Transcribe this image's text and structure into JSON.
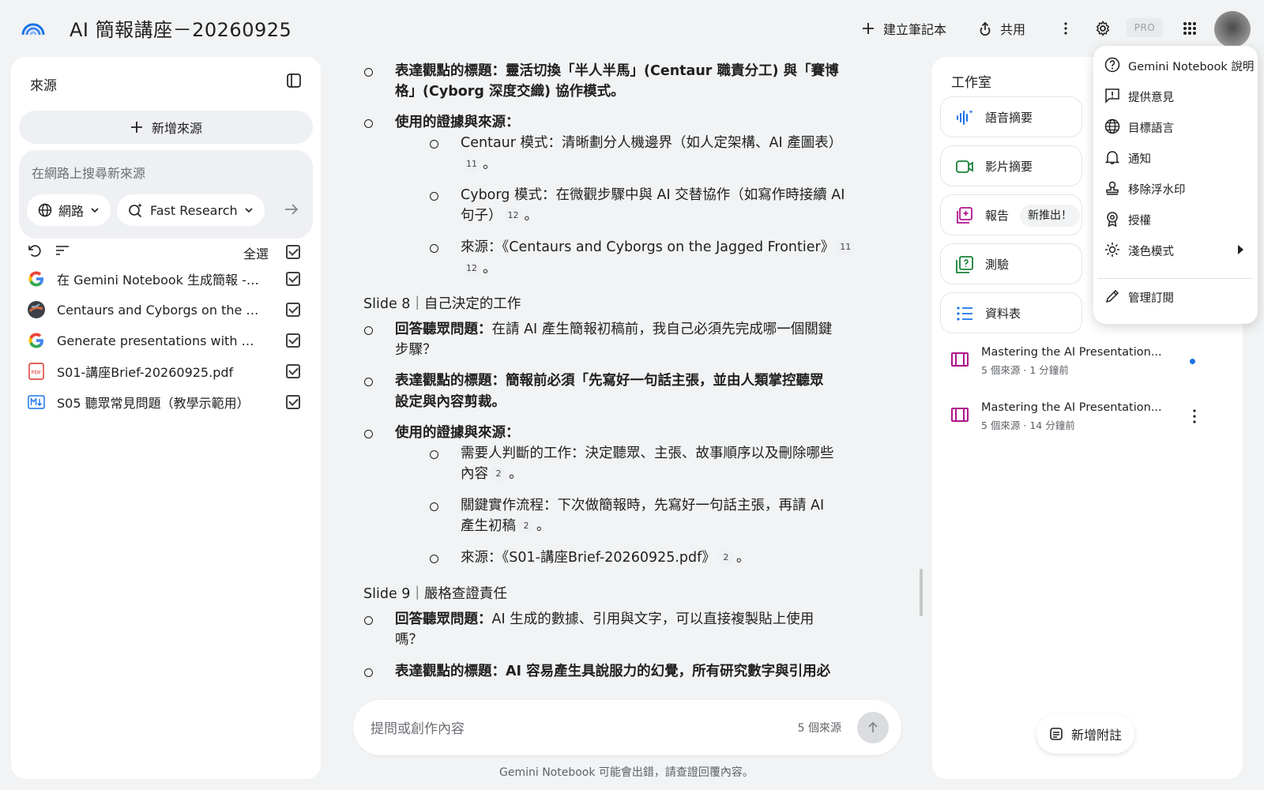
{
  "app": {
    "title": "AI 簡報講座－20260925"
  },
  "toolbar": {
    "create_notebook": "建立筆記本",
    "share": "共用",
    "pro_badge": "PRO"
  },
  "sources_panel": {
    "title": "來源",
    "add_source": "新增來源",
    "search_placeholder": "在網路上搜尋新來源",
    "web_chip": "網路",
    "research_chip": "Fast Research",
    "select_all": "全選",
    "items": [
      {
        "label": "在 Gemini Notebook 生成簡報 - ...",
        "icon": "google-icon"
      },
      {
        "label": "Centaurs and Cyborgs on the Ja...",
        "icon": "globe-favicon-icon"
      },
      {
        "label": "Generate presentations with Ge...",
        "icon": "google-icon"
      },
      {
        "label": "S01-講座Brief-20260925.pdf",
        "icon": "pdf-icon"
      },
      {
        "label": "S05 聽眾常見問題（教學示範用）",
        "icon": "markdown-icon"
      }
    ]
  },
  "content": {
    "l1a": "表達觀點的標題：",
    "l1b": "靈活切換「半人半馬」(Centaur 職責分工) 與「賽博",
    "l1c": "格」(Cyborg 深度交織) 協作模式。",
    "l2": "使用的證據與來源：",
    "l3a": "Centaur 模式：清晰劃分人機邊界（如人定架構、AI 產圖表）",
    "l3cite": "11",
    "l4a": "Cyborg 模式：在微觀步驟中與 AI 交替協作（如寫作時接續 AI",
    "l4b": "句子）",
    "l4cite": "12",
    "l5a": "來源：《Centaurs and Cyborgs on the Jagged Frontier》",
    "l5cite1": "11",
    "l5cite2": "12",
    "slide8": "Slide 8｜自己決定的工作",
    "s8q_label": "回答聽眾問題：",
    "s8q_text": "在請 AI 產生簡報初稿前，我自己必須先完成哪一個關鍵",
    "s8q_text2": "步驟？",
    "s8t_label": "表達觀點的標題：",
    "s8t_text": "簡報前必須「先寫好一句話主張，並由人類掌控聽眾",
    "s8t_text2": "設定與內容剪裁。",
    "s8e_label": "使用的證據與來源：",
    "s8e1": "需要人判斷的工作：決定聽眾、主張、故事順序以及刪除哪些",
    "s8e1b": "內容",
    "s8e1cite": "2",
    "s8e2": "關鍵實作流程：下次做簡報時，先寫好一句話主張，再請 AI",
    "s8e2b": "產生初稿",
    "s8e2cite": "2",
    "s8e3": "來源：《S01-講座Brief-20260925.pdf》",
    "s8e3cite": "2",
    "period": "。",
    "slide9": "Slide 9｜嚴格查證責任",
    "s9q_label": "回答聽眾問題：",
    "s9q_text": "AI 生成的數據、引用與文字，可以直接複製貼上使用",
    "s9q_text2": "嗎？",
    "s9t_label": "表達觀點的標題：",
    "s9t_text": "AI 容易產生具說服力的幻覺，所有研究數字與引用必"
  },
  "chat": {
    "placeholder": "提問或創作內容",
    "source_count": "5 個來源"
  },
  "footer": {
    "disclaimer": "Gemini Notebook 可能會出錯，請查證回覆內容。"
  },
  "studio": {
    "title": "工作室",
    "cards": [
      {
        "label": "語音摘要"
      },
      {
        "label": "影片摘要"
      },
      {
        "label": "報告",
        "badge": "新推出！"
      },
      {
        "label": "測驗"
      },
      {
        "label": "資料表"
      }
    ],
    "notes": [
      {
        "title": "Mastering the AI Presentation...",
        "meta": "5 個來源 · 1 分鐘前"
      },
      {
        "title": "Mastering the AI Presentation...",
        "meta": "5 個來源 · 14 分鐘前"
      }
    ],
    "add_note": "新增附註"
  },
  "menu": {
    "items": [
      {
        "label": "Gemini Notebook 說明",
        "icon": "help-icon"
      },
      {
        "label": "提供意見",
        "icon": "feedback-icon"
      },
      {
        "label": "目標語言",
        "icon": "globe-icon"
      },
      {
        "label": "通知",
        "icon": "bell-icon"
      },
      {
        "label": "移除浮水印",
        "icon": "stamp-icon"
      },
      {
        "label": "授權",
        "icon": "license-icon"
      },
      {
        "label": "淺色模式",
        "icon": "sun-icon"
      },
      {
        "label": "管理訂閱",
        "icon": "pencil-icon"
      }
    ]
  },
  "colors": {
    "accent_blue": "#1a73e8",
    "note_magenta": "#b0148a",
    "background": "#f1f3f4"
  }
}
